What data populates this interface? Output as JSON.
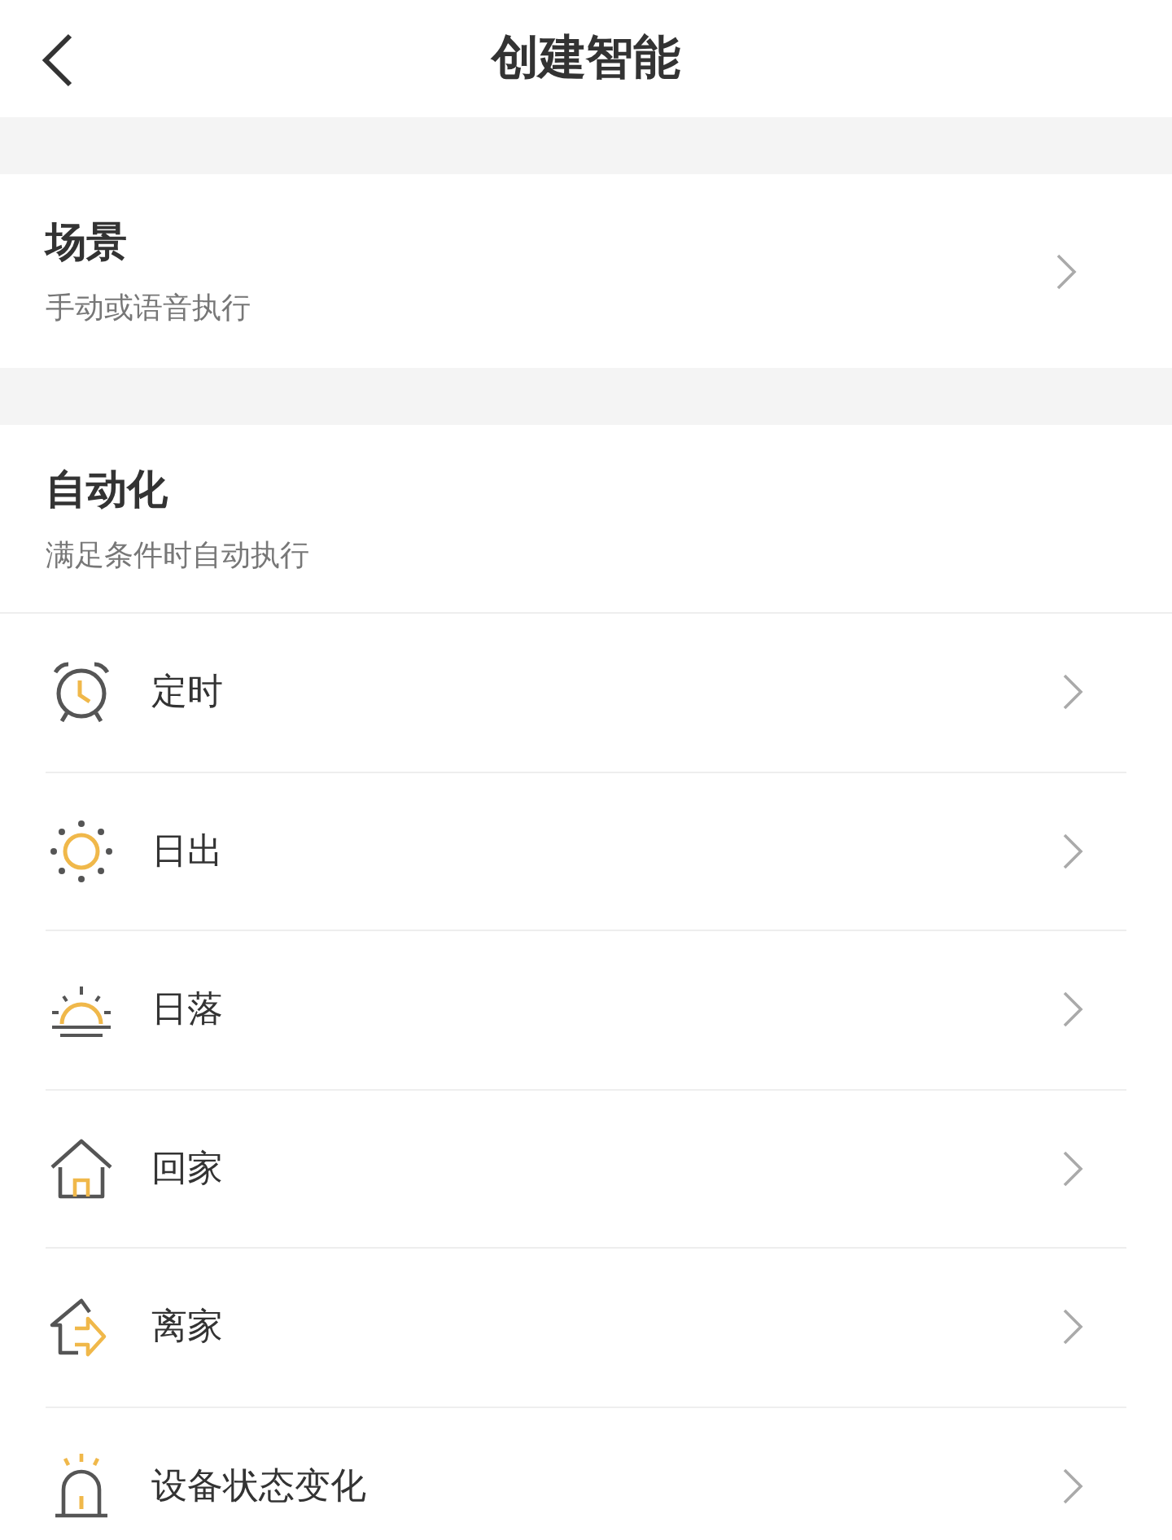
{
  "header": {
    "title": "创建智能"
  },
  "scene": {
    "title": "场景",
    "subtitle": "手动或语音执行"
  },
  "automation": {
    "title": "自动化",
    "subtitle": "满足条件时自动执行"
  },
  "items": [
    {
      "kind": "timer",
      "label": "定时"
    },
    {
      "kind": "sunrise",
      "label": "日出"
    },
    {
      "kind": "sunset",
      "label": "日落"
    },
    {
      "kind": "arrive",
      "label": "回家"
    },
    {
      "kind": "leave",
      "label": "离家"
    },
    {
      "kind": "device",
      "label": "设备状态变化"
    }
  ]
}
